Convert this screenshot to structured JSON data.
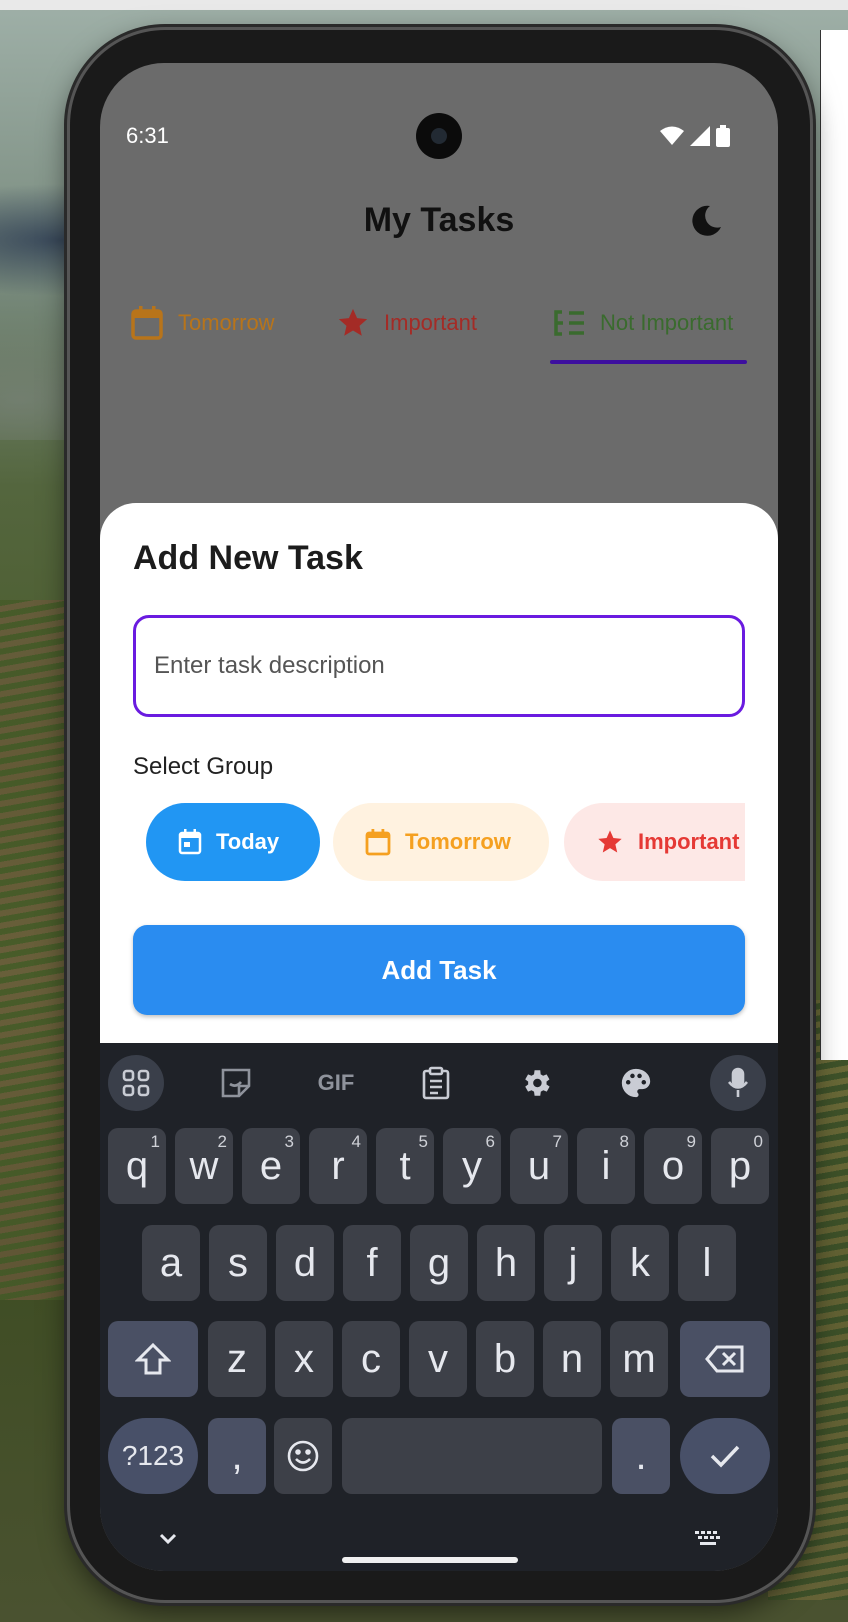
{
  "status_bar": {
    "time": "6:31"
  },
  "app_bar": {
    "title": "My Tasks",
    "theme_icon": "moon-icon"
  },
  "tabs": [
    {
      "label": "Tomorrow",
      "icon": "calendar-icon",
      "color": "#b8741a"
    },
    {
      "label": "Important",
      "icon": "star-icon",
      "color": "#a42b26"
    },
    {
      "label": "Not Important",
      "icon": "list-icon",
      "color": "#3a6b2e",
      "selected": true
    }
  ],
  "sheet": {
    "title": "Add New Task",
    "input_placeholder": "Enter task description",
    "input_value": "",
    "group_label": "Select Group",
    "chips": [
      {
        "label": "Today",
        "icon": "calendar-icon",
        "selected": true
      },
      {
        "label": "Tomorrow",
        "icon": "calendar-icon",
        "selected": false
      },
      {
        "label": "Important",
        "icon": "star-icon",
        "selected": false
      }
    ],
    "add_button": "Add Task"
  },
  "keyboard": {
    "toolbar": [
      "apps-grid-icon",
      "sticker-icon",
      "gif-icon",
      "clipboard-icon",
      "settings-gear-icon",
      "palette-icon",
      "microphone-icon"
    ],
    "gif_label": "GIF",
    "row1": [
      {
        "k": "q",
        "n": "1"
      },
      {
        "k": "w",
        "n": "2"
      },
      {
        "k": "e",
        "n": "3"
      },
      {
        "k": "r",
        "n": "4"
      },
      {
        "k": "t",
        "n": "5"
      },
      {
        "k": "y",
        "n": "6"
      },
      {
        "k": "u",
        "n": "7"
      },
      {
        "k": "i",
        "n": "8"
      },
      {
        "k": "o",
        "n": "9"
      },
      {
        "k": "p",
        "n": "0"
      }
    ],
    "row2": [
      "a",
      "s",
      "d",
      "f",
      "g",
      "h",
      "j",
      "k",
      "l"
    ],
    "row3": [
      "z",
      "x",
      "c",
      "v",
      "b",
      "n",
      "m"
    ],
    "symbols_key": "?123",
    "comma_key": ",",
    "period_key": "."
  },
  "colors": {
    "accent_purple": "#6a1be0",
    "primary_blue": "#2a8cf0",
    "chip_today": "#2196f3",
    "chip_tomorrow_text": "#f5a020",
    "chip_important_text": "#e53935"
  }
}
